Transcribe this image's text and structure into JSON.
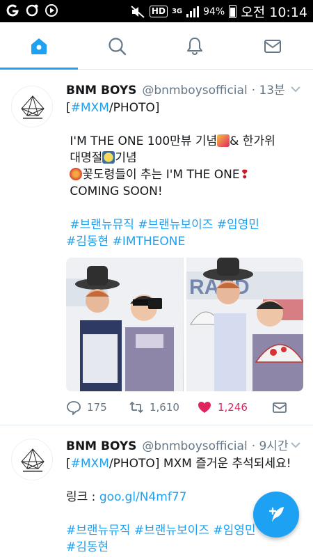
{
  "status_bar": {
    "left_icons": [
      "g-icon",
      "settings-circle-icon",
      "play-icon"
    ],
    "hd": "HD",
    "network": "3G",
    "battery": "94%",
    "time": "오전 10:14"
  },
  "tabs": [
    {
      "name": "home",
      "icon": "home-icon",
      "active": true
    },
    {
      "name": "search",
      "icon": "search-icon",
      "active": false
    },
    {
      "name": "notifications",
      "icon": "bell-icon",
      "active": false
    },
    {
      "name": "messages",
      "icon": "mail-icon",
      "active": false
    }
  ],
  "accent_color": "#1da1f2",
  "like_color": "#e0245e",
  "tweets": [
    {
      "name": "BNM BOYS",
      "handle": "@bnmboysofficial",
      "time": "· 13분",
      "tag": "#MXM",
      "tag_suffix": "/PHOTO]",
      "tag_prefix": "[",
      "lines": [
        "I'M THE ONE 100만뷰 기념",
        "& 한가위",
        "대명절",
        "기념",
        "꽃도령들이 추는 I'M THE ONE",
        "COMING SOON!"
      ],
      "hashtags_line1": [
        "#브랜뉴뮤직",
        "#브랜뉴보이즈",
        "#임영민"
      ],
      "hashtags_line2": [
        "#김동현",
        "#IMTHEONE"
      ],
      "replies": "175",
      "retweets": "1,610",
      "likes": "1,246"
    },
    {
      "name": "BNM BOYS",
      "handle": "@bnmboysofficial",
      "time": "· 9시간",
      "tag_prefix": "[",
      "tag": "#MXM",
      "tag_suffix": "/PHOTO] MXM 즐거운 추석되세요!",
      "link_label": "링크 : ",
      "link": "goo.gl/N4mf77",
      "hashtags_line1": [
        "#브랜뉴뮤직",
        "#브랜뉴보이즈",
        "#임영민"
      ],
      "hashtags_line2": [
        "#김동현"
      ]
    }
  ],
  "compose_icon": "feather-plus-icon"
}
